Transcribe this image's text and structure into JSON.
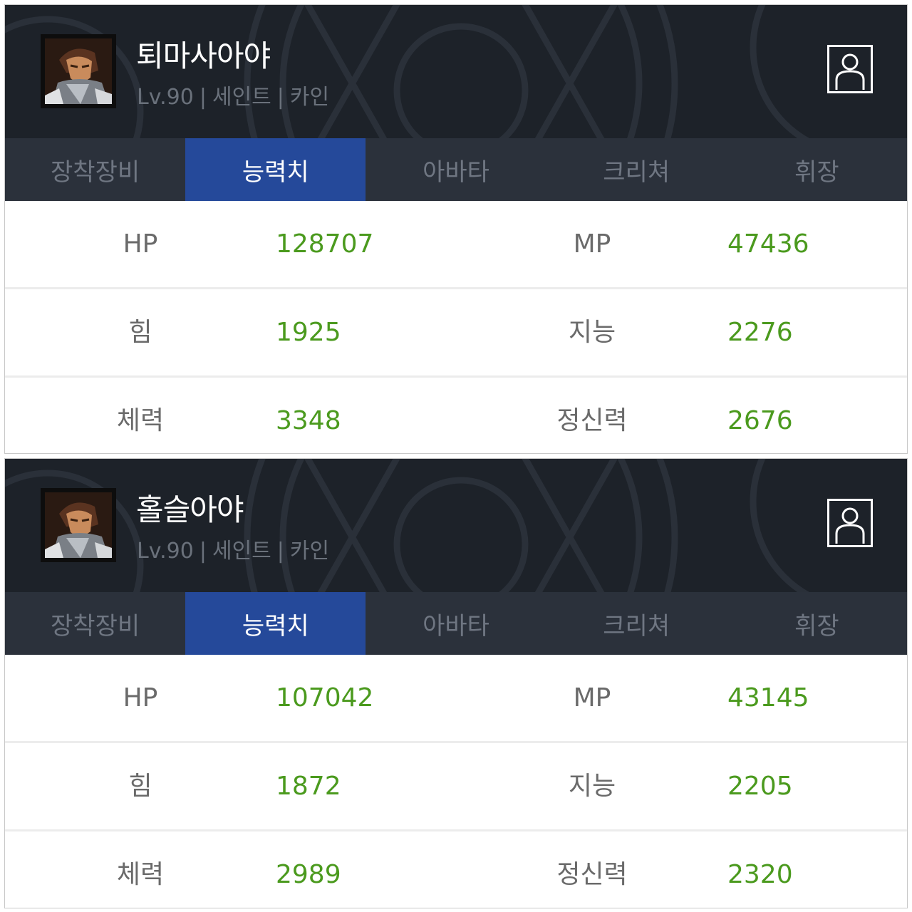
{
  "characters": [
    {
      "name": "퇴마사아야",
      "level": "Lv.90",
      "server": "세인트",
      "job": "카인",
      "separator": "|",
      "tabs": [
        "장착장비",
        "능력치",
        "아바타",
        "크리쳐",
        "휘장"
      ],
      "active_tab": "능력치",
      "stats": [
        {
          "left_label": "HP",
          "left_value": "128707",
          "right_label": "MP",
          "right_value": "47436"
        },
        {
          "left_label": "힘",
          "left_value": "1925",
          "right_label": "지능",
          "right_value": "2276"
        },
        {
          "left_label": "체력",
          "left_value": "3348",
          "right_label": "정신력",
          "right_value": "2676"
        }
      ]
    },
    {
      "name": "홀슬아야",
      "level": "Lv.90",
      "server": "세인트",
      "job": "카인",
      "separator": "|",
      "tabs": [
        "장착장비",
        "능력치",
        "아바타",
        "크리쳐",
        "휘장"
      ],
      "active_tab": "능력치",
      "stats": [
        {
          "left_label": "HP",
          "left_value": "107042",
          "right_label": "MP",
          "right_value": "43145"
        },
        {
          "left_label": "힘",
          "left_value": "1872",
          "right_label": "지능",
          "right_value": "2205"
        },
        {
          "left_label": "체력",
          "left_value": "2989",
          "right_label": "정신력",
          "right_value": "2320"
        }
      ]
    }
  ],
  "icons": {
    "profile_button": "user-profile-icon",
    "avatar": "character-portrait"
  },
  "colors": {
    "header_bg": "#1d2229",
    "tab_bg": "#2b313b",
    "tab_active": "#25499a",
    "stat_value": "#4b9a1e",
    "stat_label": "#6a6a6a"
  }
}
